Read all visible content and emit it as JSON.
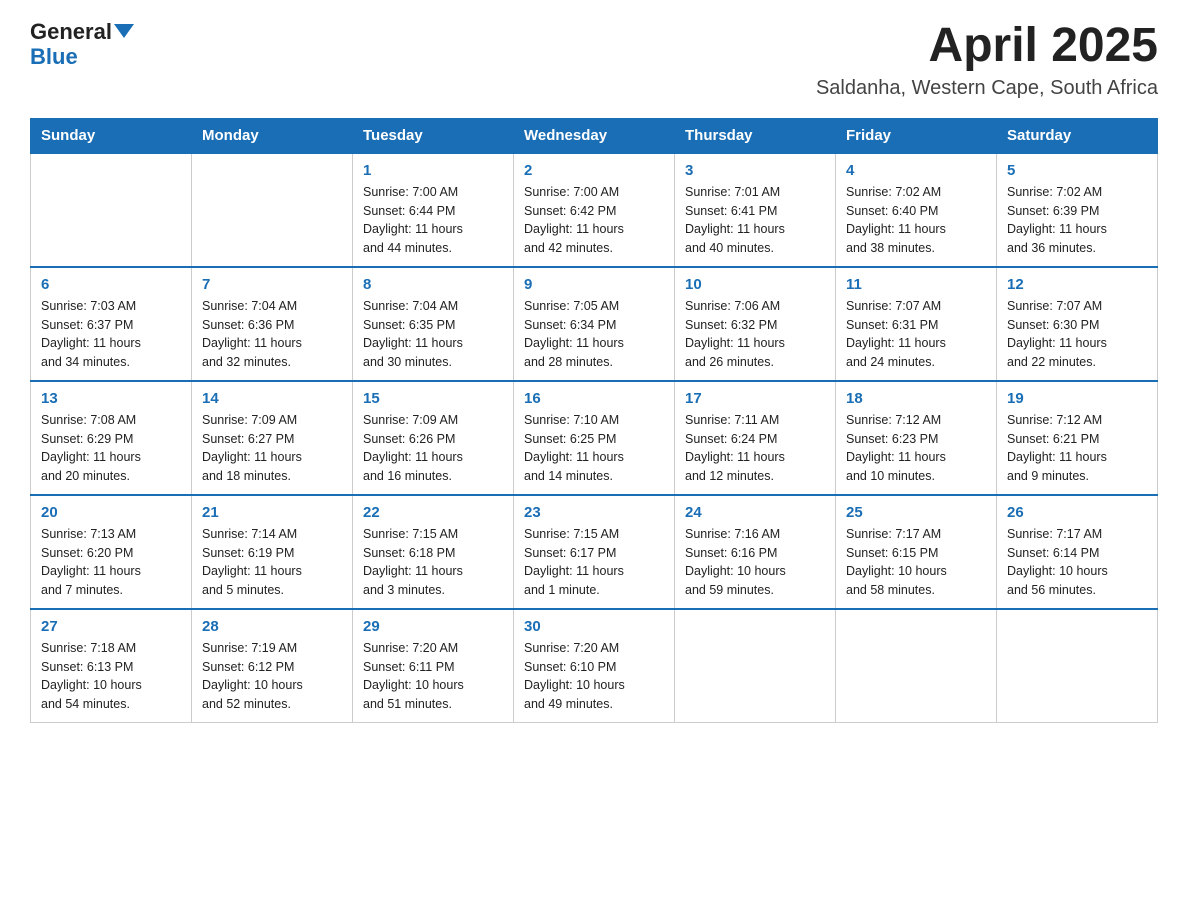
{
  "logo": {
    "line1": "General",
    "line2": "Blue"
  },
  "title": "April 2025",
  "subtitle": "Saldanha, Western Cape, South Africa",
  "weekdays": [
    "Sunday",
    "Monday",
    "Tuesday",
    "Wednesday",
    "Thursday",
    "Friday",
    "Saturday"
  ],
  "weeks": [
    [
      {
        "day": "",
        "info": []
      },
      {
        "day": "",
        "info": []
      },
      {
        "day": "1",
        "info": [
          "Sunrise: 7:00 AM",
          "Sunset: 6:44 PM",
          "Daylight: 11 hours",
          "and 44 minutes."
        ]
      },
      {
        "day": "2",
        "info": [
          "Sunrise: 7:00 AM",
          "Sunset: 6:42 PM",
          "Daylight: 11 hours",
          "and 42 minutes."
        ]
      },
      {
        "day": "3",
        "info": [
          "Sunrise: 7:01 AM",
          "Sunset: 6:41 PM",
          "Daylight: 11 hours",
          "and 40 minutes."
        ]
      },
      {
        "day": "4",
        "info": [
          "Sunrise: 7:02 AM",
          "Sunset: 6:40 PM",
          "Daylight: 11 hours",
          "and 38 minutes."
        ]
      },
      {
        "day": "5",
        "info": [
          "Sunrise: 7:02 AM",
          "Sunset: 6:39 PM",
          "Daylight: 11 hours",
          "and 36 minutes."
        ]
      }
    ],
    [
      {
        "day": "6",
        "info": [
          "Sunrise: 7:03 AM",
          "Sunset: 6:37 PM",
          "Daylight: 11 hours",
          "and 34 minutes."
        ]
      },
      {
        "day": "7",
        "info": [
          "Sunrise: 7:04 AM",
          "Sunset: 6:36 PM",
          "Daylight: 11 hours",
          "and 32 minutes."
        ]
      },
      {
        "day": "8",
        "info": [
          "Sunrise: 7:04 AM",
          "Sunset: 6:35 PM",
          "Daylight: 11 hours",
          "and 30 minutes."
        ]
      },
      {
        "day": "9",
        "info": [
          "Sunrise: 7:05 AM",
          "Sunset: 6:34 PM",
          "Daylight: 11 hours",
          "and 28 minutes."
        ]
      },
      {
        "day": "10",
        "info": [
          "Sunrise: 7:06 AM",
          "Sunset: 6:32 PM",
          "Daylight: 11 hours",
          "and 26 minutes."
        ]
      },
      {
        "day": "11",
        "info": [
          "Sunrise: 7:07 AM",
          "Sunset: 6:31 PM",
          "Daylight: 11 hours",
          "and 24 minutes."
        ]
      },
      {
        "day": "12",
        "info": [
          "Sunrise: 7:07 AM",
          "Sunset: 6:30 PM",
          "Daylight: 11 hours",
          "and 22 minutes."
        ]
      }
    ],
    [
      {
        "day": "13",
        "info": [
          "Sunrise: 7:08 AM",
          "Sunset: 6:29 PM",
          "Daylight: 11 hours",
          "and 20 minutes."
        ]
      },
      {
        "day": "14",
        "info": [
          "Sunrise: 7:09 AM",
          "Sunset: 6:27 PM",
          "Daylight: 11 hours",
          "and 18 minutes."
        ]
      },
      {
        "day": "15",
        "info": [
          "Sunrise: 7:09 AM",
          "Sunset: 6:26 PM",
          "Daylight: 11 hours",
          "and 16 minutes."
        ]
      },
      {
        "day": "16",
        "info": [
          "Sunrise: 7:10 AM",
          "Sunset: 6:25 PM",
          "Daylight: 11 hours",
          "and 14 minutes."
        ]
      },
      {
        "day": "17",
        "info": [
          "Sunrise: 7:11 AM",
          "Sunset: 6:24 PM",
          "Daylight: 11 hours",
          "and 12 minutes."
        ]
      },
      {
        "day": "18",
        "info": [
          "Sunrise: 7:12 AM",
          "Sunset: 6:23 PM",
          "Daylight: 11 hours",
          "and 10 minutes."
        ]
      },
      {
        "day": "19",
        "info": [
          "Sunrise: 7:12 AM",
          "Sunset: 6:21 PM",
          "Daylight: 11 hours",
          "and 9 minutes."
        ]
      }
    ],
    [
      {
        "day": "20",
        "info": [
          "Sunrise: 7:13 AM",
          "Sunset: 6:20 PM",
          "Daylight: 11 hours",
          "and 7 minutes."
        ]
      },
      {
        "day": "21",
        "info": [
          "Sunrise: 7:14 AM",
          "Sunset: 6:19 PM",
          "Daylight: 11 hours",
          "and 5 minutes."
        ]
      },
      {
        "day": "22",
        "info": [
          "Sunrise: 7:15 AM",
          "Sunset: 6:18 PM",
          "Daylight: 11 hours",
          "and 3 minutes."
        ]
      },
      {
        "day": "23",
        "info": [
          "Sunrise: 7:15 AM",
          "Sunset: 6:17 PM",
          "Daylight: 11 hours",
          "and 1 minute."
        ]
      },
      {
        "day": "24",
        "info": [
          "Sunrise: 7:16 AM",
          "Sunset: 6:16 PM",
          "Daylight: 10 hours",
          "and 59 minutes."
        ]
      },
      {
        "day": "25",
        "info": [
          "Sunrise: 7:17 AM",
          "Sunset: 6:15 PM",
          "Daylight: 10 hours",
          "and 58 minutes."
        ]
      },
      {
        "day": "26",
        "info": [
          "Sunrise: 7:17 AM",
          "Sunset: 6:14 PM",
          "Daylight: 10 hours",
          "and 56 minutes."
        ]
      }
    ],
    [
      {
        "day": "27",
        "info": [
          "Sunrise: 7:18 AM",
          "Sunset: 6:13 PM",
          "Daylight: 10 hours",
          "and 54 minutes."
        ]
      },
      {
        "day": "28",
        "info": [
          "Sunrise: 7:19 AM",
          "Sunset: 6:12 PM",
          "Daylight: 10 hours",
          "and 52 minutes."
        ]
      },
      {
        "day": "29",
        "info": [
          "Sunrise: 7:20 AM",
          "Sunset: 6:11 PM",
          "Daylight: 10 hours",
          "and 51 minutes."
        ]
      },
      {
        "day": "30",
        "info": [
          "Sunrise: 7:20 AM",
          "Sunset: 6:10 PM",
          "Daylight: 10 hours",
          "and 49 minutes."
        ]
      },
      {
        "day": "",
        "info": []
      },
      {
        "day": "",
        "info": []
      },
      {
        "day": "",
        "info": []
      }
    ]
  ]
}
